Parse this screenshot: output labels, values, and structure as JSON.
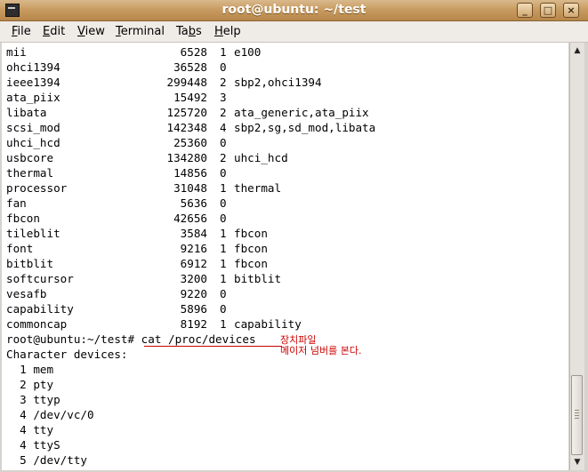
{
  "window": {
    "title": "root@ubuntu: ~/test"
  },
  "titlebar_buttons": {
    "minimize": "_",
    "maximize": "□",
    "close": "×"
  },
  "menu": [
    "File",
    "Edit",
    "View",
    "Terminal",
    "Tabs",
    "Help"
  ],
  "menu_mnemonics": [
    "F",
    "E",
    "V",
    "T",
    "b",
    "H"
  ],
  "modules": [
    {
      "name": "mii",
      "size": "6528",
      "used": "1",
      "by": "e100"
    },
    {
      "name": "ohci1394",
      "size": "36528",
      "used": "0",
      "by": ""
    },
    {
      "name": "ieee1394",
      "size": "299448",
      "used": "2",
      "by": "sbp2,ohci1394"
    },
    {
      "name": "ata_piix",
      "size": "15492",
      "used": "3",
      "by": ""
    },
    {
      "name": "libata",
      "size": "125720",
      "used": "2",
      "by": "ata_generic,ata_piix"
    },
    {
      "name": "scsi_mod",
      "size": "142348",
      "used": "4",
      "by": "sbp2,sg,sd_mod,libata"
    },
    {
      "name": "uhci_hcd",
      "size": "25360",
      "used": "0",
      "by": ""
    },
    {
      "name": "usbcore",
      "size": "134280",
      "used": "2",
      "by": "uhci_hcd"
    },
    {
      "name": "thermal",
      "size": "14856",
      "used": "0",
      "by": ""
    },
    {
      "name": "processor",
      "size": "31048",
      "used": "1",
      "by": "thermal"
    },
    {
      "name": "fan",
      "size": "5636",
      "used": "0",
      "by": ""
    },
    {
      "name": "fbcon",
      "size": "42656",
      "used": "0",
      "by": ""
    },
    {
      "name": "tileblit",
      "size": "3584",
      "used": "1",
      "by": "fbcon"
    },
    {
      "name": "font",
      "size": "9216",
      "used": "1",
      "by": "fbcon"
    },
    {
      "name": "bitblit",
      "size": "6912",
      "used": "1",
      "by": "fbcon"
    },
    {
      "name": "softcursor",
      "size": "3200",
      "used": "1",
      "by": "bitblit"
    },
    {
      "name": "vesafb",
      "size": "9220",
      "used": "0",
      "by": ""
    },
    {
      "name": "capability",
      "size": "5896",
      "used": "0",
      "by": ""
    },
    {
      "name": "commoncap",
      "size": "8192",
      "used": "1",
      "by": "capability"
    }
  ],
  "prompt": {
    "text": "root@ubuntu:~/test# ",
    "command": "cat /proc/devices"
  },
  "output": [
    "Character devices:",
    "  1 mem",
    "  2 pty",
    "  3 ttyp",
    "  4 /dev/vc/0",
    "  4 tty",
    "  4 ttyS",
    "  5 /dev/tty"
  ],
  "annotation": {
    "line1": "장치파일",
    "line2": "메이저 넘버를 본다.",
    "color": "#cc0000"
  },
  "scrollbar": {
    "up_icon": "▲",
    "down_icon": "▼",
    "position": 0.9
  }
}
